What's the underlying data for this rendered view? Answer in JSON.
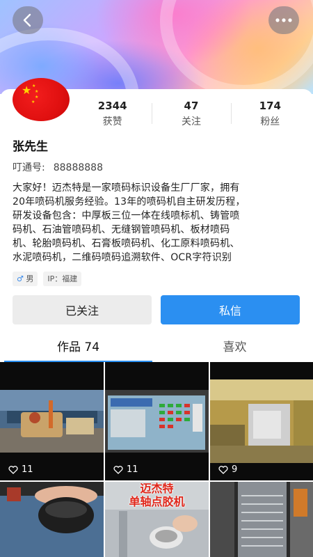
{
  "header": {
    "back_icon": "chevron-left-icon",
    "more_icon": "more-dots-icon"
  },
  "stats": [
    {
      "value": "2344",
      "label": "获赞"
    },
    {
      "value": "47",
      "label": "关注"
    },
    {
      "value": "174",
      "label": "粉丝"
    }
  ],
  "profile": {
    "name": "张先生",
    "id_label": "叮通号:",
    "id_value": "88888888",
    "bio_lines": [
      "大家好！迈杰特是一家喷码标识设备生厂厂家，拥有",
      "20年喷码机服务经验。13年的喷码机自主研发历程，",
      "研发设备包含：中厚板三位一体在线喷标机、铸管喷",
      "码机、石油管喷码机、无缝钢管喷码机、板材喷码",
      "机、轮胎喷码机、石膏板喷码机、化工原料喷码机、",
      "水泥喷码机，二维码喷码追溯软件、OCR字符识别"
    ],
    "gender_tag": "男",
    "ip_tag": "IP：福建"
  },
  "actions": {
    "follow_label": "已关注",
    "message_label": "私信"
  },
  "tabs": [
    {
      "label": "作品 74",
      "active": true
    },
    {
      "label": "喜欢",
      "active": false
    }
  ],
  "videos": [
    {
      "likes": "11"
    },
    {
      "likes": "11"
    },
    {
      "likes": "9"
    },
    {
      "likes": ""
    },
    {
      "likes": "",
      "overlay_lines": [
        "迈杰特",
        "单轴点胶机"
      ]
    },
    {
      "likes": ""
    }
  ],
  "colors": {
    "accent": "#2b8ff1",
    "follow_bg": "#ececec"
  }
}
